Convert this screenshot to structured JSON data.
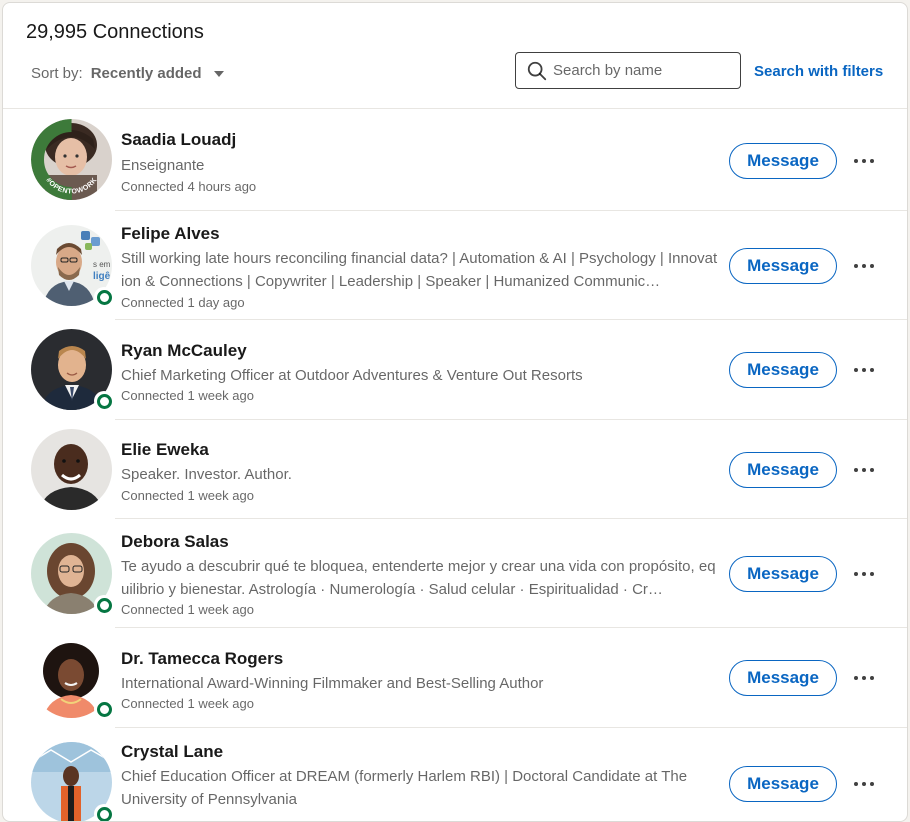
{
  "header": {
    "connections_count": "29,995 Connections",
    "sort_label": "Sort by:",
    "sort_value": "Recently added",
    "search_placeholder": "Search by name",
    "filters_link": "Search with filters"
  },
  "message_label": "Message",
  "connections": [
    {
      "name": "Saadia Louadj",
      "headline": "Enseignante",
      "connected": "Connected 4 hours ago",
      "open_to_work": true,
      "badge_text": "#OPENTOWORK",
      "online": false
    },
    {
      "name": "Felipe Alves",
      "headline": "Still working late hours reconciling financial data? | Automation & AI | Psychology | Innovation & Connections | Copywriter | Leadership | Speaker | Humanized Communic…",
      "connected": "Connected 1 day ago",
      "online": true
    },
    {
      "name": "Ryan McCauley",
      "headline": "Chief Marketing Officer at Outdoor Adventures & Venture Out Resorts",
      "connected": "Connected 1 week ago",
      "online": true
    },
    {
      "name": "Elie Eweka",
      "headline": "Speaker. Investor. Author.",
      "connected": "Connected 1 week ago",
      "online": false
    },
    {
      "name": "Debora Salas",
      "headline": "Te ayudo a descubrir qué te bloquea, entenderte mejor y crear una vida con propósito, equilibrio y bienestar. Astrología · Numerología · Salud celular · Espiritualidad · Cr…",
      "connected": "Connected 1 week ago",
      "online": true
    },
    {
      "name": "Dr. Tamecca Rogers",
      "headline": "International Award-Winning Filmmaker and Best-Selling Author",
      "connected": "Connected 1 week ago",
      "online": true
    },
    {
      "name": "Crystal Lane",
      "headline": "Chief Education Officer at DREAM (formerly Harlem RBI) | Doctoral Candidate at The University of Pennsylvania",
      "connected": "",
      "online": true
    }
  ],
  "colors": {
    "accent": "#0a66c2",
    "online": "#057642",
    "open_to_work": "#3d7a3a"
  }
}
